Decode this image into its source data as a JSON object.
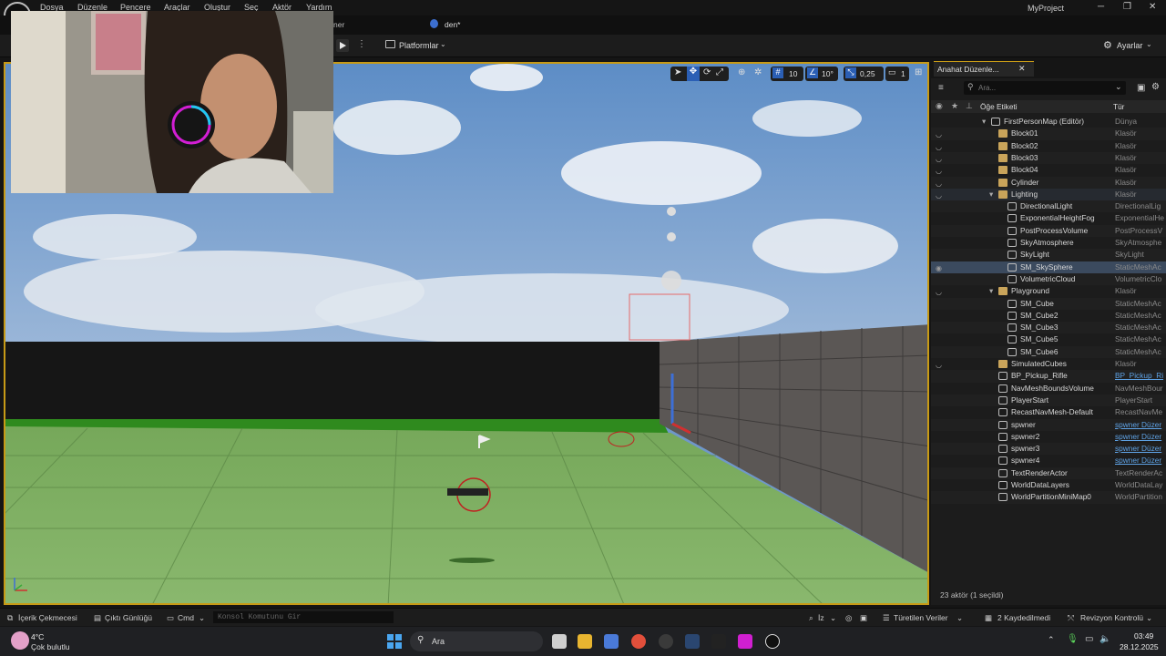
{
  "menu": [
    "Dosya",
    "Düzenle",
    "Pencere",
    "Araçlar",
    "Oluştur",
    "Seç",
    "Aktör",
    "Yardım"
  ],
  "project_name": "MyProject",
  "tabs": {
    "map_tab_partial": "ner",
    "blueprint_tab": "den*"
  },
  "toolbar": {
    "platforms_label": "Platformlar",
    "settings_label": "Ayarlar"
  },
  "viewport_toolbar": {
    "grid_snap": "10",
    "rotation_snap": "10°",
    "scale_snap": "0,25",
    "camera_speed": "1"
  },
  "outliner": {
    "tab_title": "Anahat Düzenle...",
    "search_placeholder": "Ara...",
    "col_label": "Öğe Etiketi",
    "col_type": "Tür",
    "rows": [
      {
        "name": "FirstPersonMap (Editör)",
        "type": "Dünya",
        "indent": 0
      },
      {
        "name": "Block01",
        "type": "Klasör",
        "indent": 1
      },
      {
        "name": "Block02",
        "type": "Klasör",
        "indent": 1
      },
      {
        "name": "Block03",
        "type": "Klasör",
        "indent": 1
      },
      {
        "name": "Block04",
        "type": "Klasör",
        "indent": 1
      },
      {
        "name": "Cylinder",
        "type": "Klasör",
        "indent": 1
      },
      {
        "name": "Lighting",
        "type": "Klasör",
        "indent": 1
      },
      {
        "name": "DirectionalLight",
        "type": "DirectionalLig",
        "indent": 2
      },
      {
        "name": "ExponentialHeightFog",
        "type": "ExponentialHe",
        "indent": 2
      },
      {
        "name": "PostProcessVolume",
        "type": "PostProcessV",
        "indent": 2
      },
      {
        "name": "SkyAtmosphere",
        "type": "SkyAtmosphe",
        "indent": 2
      },
      {
        "name": "SkyLight",
        "type": "SkyLight",
        "indent": 2
      },
      {
        "name": "SM_SkySphere",
        "type": "StaticMeshAc",
        "indent": 2
      },
      {
        "name": "VolumetricCloud",
        "type": "VolumetricClo",
        "indent": 2
      },
      {
        "name": "Playground",
        "type": "Klasör",
        "indent": 1
      },
      {
        "name": "SM_Cube",
        "type": "StaticMeshAc",
        "indent": 2
      },
      {
        "name": "SM_Cube2",
        "type": "StaticMeshAc",
        "indent": 2
      },
      {
        "name": "SM_Cube3",
        "type": "StaticMeshAc",
        "indent": 2
      },
      {
        "name": "SM_Cube5",
        "type": "StaticMeshAc",
        "indent": 2
      },
      {
        "name": "SM_Cube6",
        "type": "StaticMeshAc",
        "indent": 2
      },
      {
        "name": "SimulatedCubes",
        "type": "Klasör",
        "indent": 1
      },
      {
        "name": "BP_Pickup_Rifle",
        "type": "BP_Pickup_Ri",
        "indent": 1
      },
      {
        "name": "NavMeshBoundsVolume",
        "type": "NavMeshBour",
        "indent": 1
      },
      {
        "name": "PlayerStart",
        "type": "PlayerStart",
        "indent": 1
      },
      {
        "name": "RecastNavMesh-Default",
        "type": "RecastNavMe",
        "indent": 1
      },
      {
        "name": "spwner",
        "type": "spwner Düzer",
        "indent": 1
      },
      {
        "name": "spwner2",
        "type": "spwner Düzer",
        "indent": 1
      },
      {
        "name": "spwner3",
        "type": "spwner Düzer",
        "indent": 1
      },
      {
        "name": "spwner4",
        "type": "spwner Düzer",
        "indent": 1
      },
      {
        "name": "TextRenderActor",
        "type": "TextRenderAc",
        "indent": 1
      },
      {
        "name": "WorldDataLayers",
        "type": "WorldDataLay",
        "indent": 1
      },
      {
        "name": "WorldPartitionMiniMap0",
        "type": "WorldPartition",
        "indent": 1
      }
    ],
    "footer": "23 aktör (1 seçildi)"
  },
  "statusbar": {
    "content_drawer": "İçerik Çekmecesi",
    "output_log": "Çıktı Günlüğü",
    "cmd": "Cmd",
    "console_placeholder": "Konsol Komutunu Gir",
    "trace": "İz",
    "derived_data": "Türetilen Veriler",
    "unsaved": "2 Kaydedilmedi",
    "revision": "Revizyon Kontrolü"
  },
  "taskbar": {
    "temperature": "4°C",
    "weather": "Çok bulutlu",
    "search": "Ara",
    "time": "03:49",
    "date": "28.12.2025"
  }
}
